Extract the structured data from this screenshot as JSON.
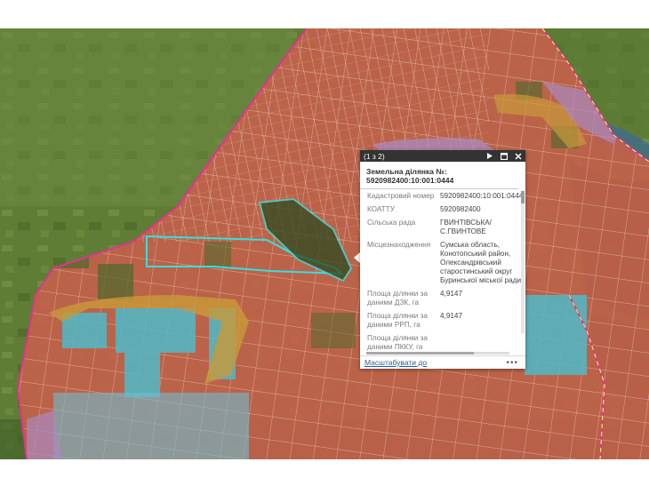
{
  "popup": {
    "counter": "(1 з 2)",
    "title_line1": "Земельна ділянка №:",
    "title_line2": "5920982400:10:001:0444",
    "tools": {
      "next_icon": "play-icon",
      "maximize_icon": "square-icon",
      "close_icon": "close-icon"
    },
    "fields": [
      {
        "name": "Кадастровий номер",
        "value": "5920982400:10:001:0444"
      },
      {
        "name": "КОАТТУ",
        "value": "5920982400"
      },
      {
        "name": "Сільська рада",
        "value": "ГВИНТІВСЬКА/С.ГВИНТОВЕ"
      },
      {
        "name": "Місцезнаходження",
        "value": "Сумська область,\nКонотопський район,\nОлександрівський\nстаростинський округ\nБуринської міської ради"
      },
      {
        "name": "Площа ділянки за даними ДЗК, га",
        "value": "4,9147"
      },
      {
        "name": "Площа ділянки за даними РРП, га",
        "value": "4,9147"
      },
      {
        "name": "Площа ділянки за даними ПККУ, га",
        "value": ""
      }
    ],
    "zoom_link": "Масштабувати до",
    "more_label": "•••"
  },
  "colors": {
    "parcel_fill": "#c8604c",
    "parcel_line": "#f3d3c8",
    "boundary": "#e0338f",
    "boundary_yellow": "#f2e46a",
    "highlight": "#33e0e0",
    "water_parcel": "#4fb8c8",
    "ochre": "#c89a3a",
    "lilac": "#a98ac0",
    "header": "#333333"
  }
}
